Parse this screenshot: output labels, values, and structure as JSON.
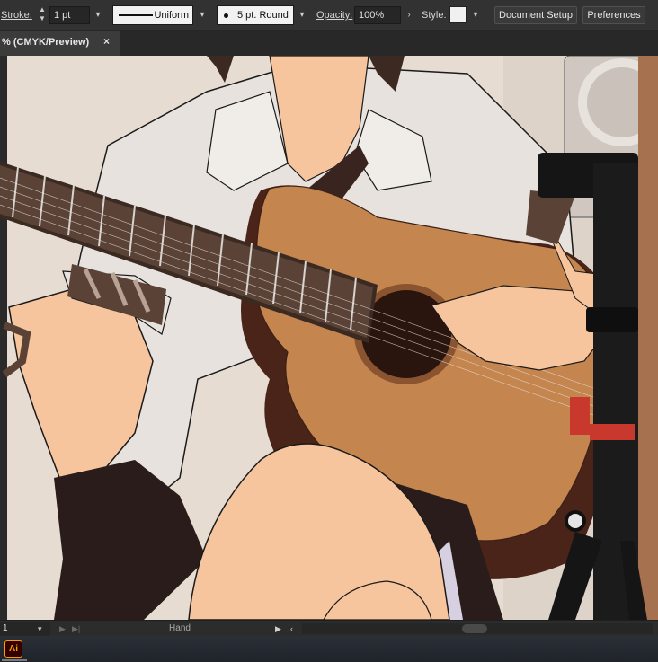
{
  "control_bar": {
    "stroke_label": "Stroke:",
    "stroke_weight": "1 pt",
    "variable_width_profile": "Uniform",
    "brush_definition": "5 pt. Round",
    "opacity_label": "Opacity:",
    "opacity_value": "100%",
    "style_label": "Style:",
    "style_swatch_color": "#f0f0f0",
    "document_setup_label": "Document Setup",
    "preferences_label": "Preferences"
  },
  "document_tab": {
    "label": "% (CMYK/Preview)",
    "close_glyph": "×"
  },
  "artwork": {
    "description_icon": "illustration-canvas",
    "colors": {
      "background": "#e7dcd2",
      "shirt": "#e8e2de",
      "skin": "#f6c59e",
      "guitar_body": "#c4854f",
      "guitar_side": "#4a2418",
      "fretboard": "#5a4236",
      "sound_hole": "#2a140e",
      "hair": "#3c2a22",
      "skirt": "#2a1c1a",
      "tripod": "#151515",
      "red_knob": "#c8382c",
      "wood_edge": "#a6714e"
    }
  },
  "status_bar": {
    "zoom": "1",
    "tool_name": "Hand"
  },
  "taskbar": {
    "app_icon_label": "Ai"
  }
}
